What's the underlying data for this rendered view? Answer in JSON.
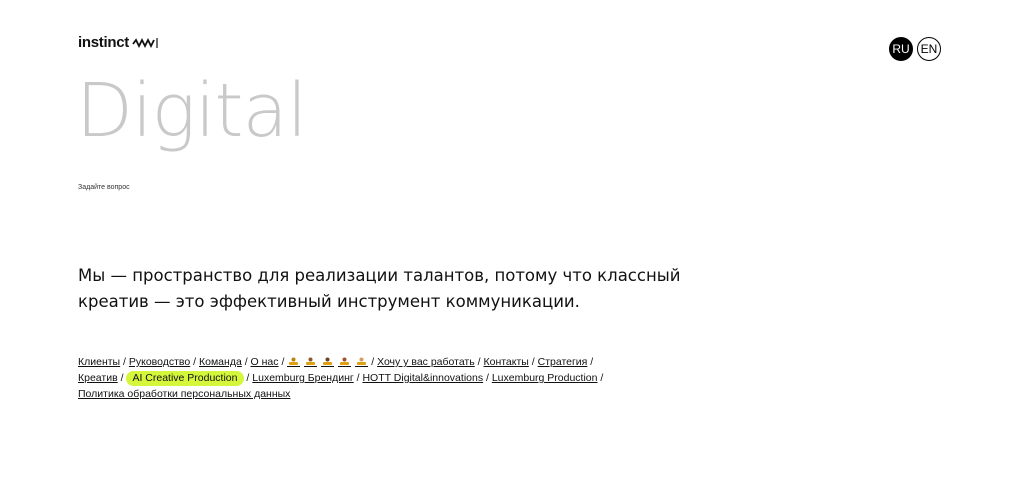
{
  "header": {
    "logo_text": "instinct",
    "logo_icon": "wave-mark-icon",
    "languages": [
      {
        "label": "RU",
        "active": true
      },
      {
        "label": "EN",
        "active": false
      }
    ]
  },
  "hero": {
    "title": "Digital",
    "ask_link": "Задайте вопрос"
  },
  "tagline": {
    "line1": "Мы — пространство для реализации талантов, потому что классный",
    "line2": "креатив — это эффективный инструмент коммуникации."
  },
  "nav": {
    "clients": "Клиенты",
    "leadership": "Руководство",
    "team": "Команда",
    "about": "О нас",
    "work_with_you": "Хочу у вас работать",
    "contacts": "Контакты",
    "strategy": "Стратегия",
    "creative": "Креатив",
    "ai_creative": "AI Creative Production",
    "luxembourg_branding": "Luxemburg Брендинг",
    "hott": "HOTT Digital&innovations",
    "luxembourg_production": "Luxemburg Production",
    "privacy": "Политика обработки персональных данных",
    "separator": "/"
  },
  "colors": {
    "accent_highlight": "#d4f63b",
    "hero_gray": "#c9c9c9",
    "text": "#111111"
  }
}
